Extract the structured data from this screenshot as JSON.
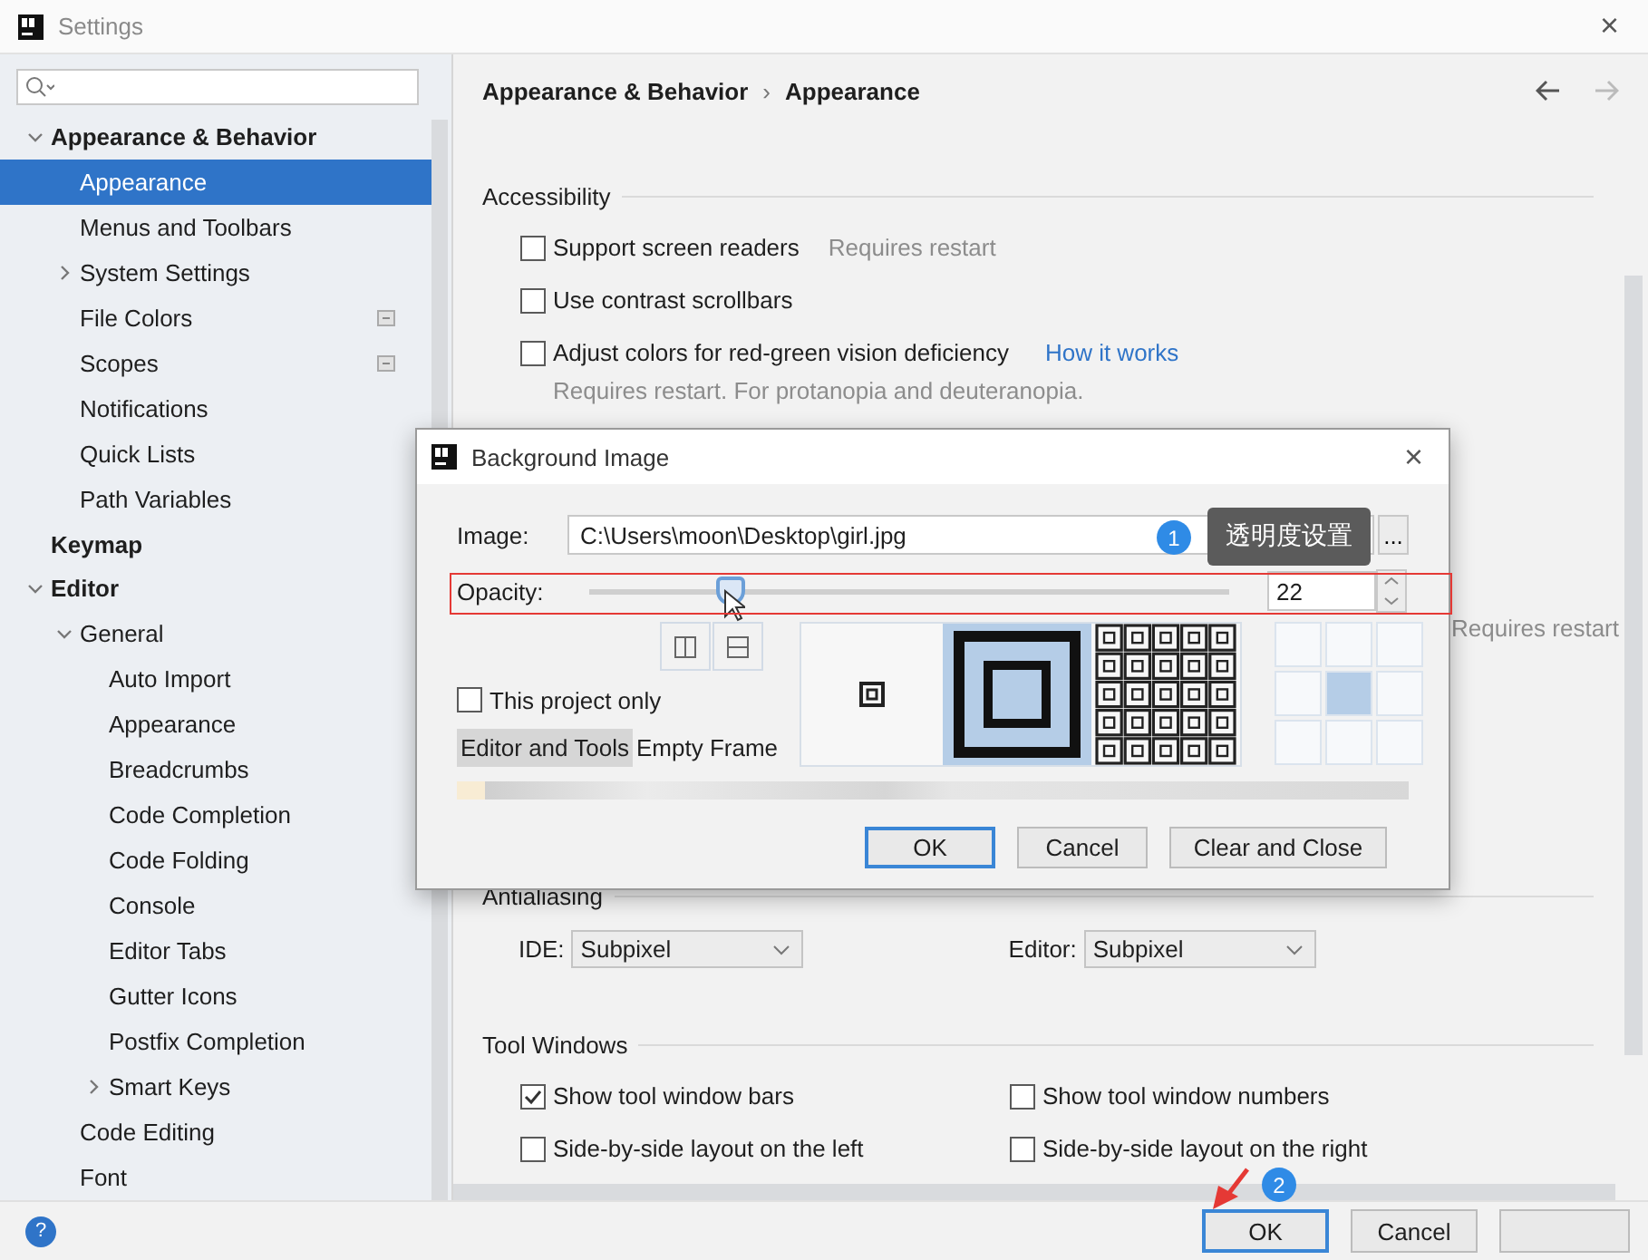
{
  "window": {
    "title": "Settings",
    "close": "×"
  },
  "sidebar": {
    "items": [
      {
        "label": "Appearance & Behavior",
        "bold": true,
        "expanded": true,
        "children": [
          {
            "label": "Appearance",
            "selected": true
          },
          {
            "label": "Menus and Toolbars",
            "selected": false
          },
          {
            "label": "System Settings",
            "selected": false,
            "expanded": false
          },
          {
            "label": "File Colors",
            "selected": false,
            "kind": "project"
          },
          {
            "label": "Scopes",
            "selected": false,
            "kind": "project"
          },
          {
            "label": "Notifications",
            "selected": false
          },
          {
            "label": "Quick Lists",
            "selected": false
          },
          {
            "label": "Path Variables",
            "selected": false
          }
        ]
      },
      {
        "label": "Keymap",
        "bold": true,
        "selected": false
      },
      {
        "label": "Editor",
        "bold": true,
        "expanded": true,
        "selected": false,
        "children": [
          {
            "label": "General",
            "expanded": true,
            "selected": false,
            "children": [
              {
                "label": "Auto Import",
                "selected": false
              },
              {
                "label": "Appearance",
                "selected": false
              },
              {
                "label": "Breadcrumbs",
                "selected": false
              },
              {
                "label": "Code Completion",
                "selected": false
              },
              {
                "label": "Code Folding",
                "selected": false
              },
              {
                "label": "Console",
                "selected": false
              },
              {
                "label": "Editor Tabs",
                "selected": false
              },
              {
                "label": "Gutter Icons",
                "selected": false
              },
              {
                "label": "Postfix Completion",
                "selected": false
              },
              {
                "label": "Smart Keys",
                "selected": false,
                "expanded": false
              }
            ]
          },
          {
            "label": "Code Editing",
            "selected": false
          },
          {
            "label": "Font",
            "selected": false
          }
        ]
      }
    ]
  },
  "breadcrumb": {
    "parts": [
      "Appearance & Behavior",
      "Appearance"
    ],
    "separator": "›"
  },
  "accessibility": {
    "title": "Accessibility",
    "options": [
      {
        "label": "Support screen readers",
        "checked": false,
        "hint": "Requires restart"
      },
      {
        "label": "Use contrast scrollbars",
        "checked": false
      },
      {
        "label": "Adjust colors for red-green vision deficiency",
        "checked": false,
        "link": "How it works",
        "note": "Requires restart. For protanopia and deuteranopia."
      }
    ]
  },
  "partly_covered_hint": "Requires restart",
  "antialiasing": {
    "title": "Antialiasing",
    "combos": [
      {
        "label": "IDE:",
        "value": "Subpixel"
      },
      {
        "label": "Editor:",
        "value": "Subpixel"
      }
    ]
  },
  "tool_windows": {
    "title": "Tool Windows",
    "options": [
      {
        "label": "Show tool window bars",
        "checked": true
      },
      {
        "label": "Show tool window numbers",
        "checked": false
      },
      {
        "label": "Side-by-side layout on the left",
        "checked": false
      },
      {
        "label": "Side-by-side layout on the right",
        "checked": false
      }
    ]
  },
  "footer": {
    "help": "?",
    "buttons": [
      {
        "label": "OK",
        "default": true
      },
      {
        "label": "Cancel",
        "default": false
      }
    ]
  },
  "dialog": {
    "title": "Background Image",
    "close": "×",
    "image": {
      "label": "Image:",
      "value": "C:\\Users\\moon\\Desktop\\girl.jpg",
      "browse": "..."
    },
    "opacity": {
      "label": "Opacity:",
      "level": 0.22,
      "value": "22"
    },
    "this_project_only": {
      "label": "This project only",
      "checked": false
    },
    "targets": [
      {
        "label": "Editor and Tools",
        "selected": true
      },
      {
        "label": "Empty Frame",
        "selected": false
      }
    ],
    "fill_modes": [
      {
        "kind": "centered",
        "selected": false
      },
      {
        "kind": "scaled",
        "selected": true
      },
      {
        "kind": "tiled",
        "selected": false
      }
    ],
    "anchors": [
      {
        "selected": false
      },
      {
        "selected": false
      },
      {
        "selected": false
      },
      {
        "selected": false
      },
      {
        "selected": true
      },
      {
        "selected": false
      },
      {
        "selected": false
      },
      {
        "selected": false
      },
      {
        "selected": false
      }
    ],
    "buttons": [
      {
        "label": "OK",
        "default": true
      },
      {
        "label": "Cancel",
        "default": false
      },
      {
        "label": "Clear and Close",
        "default": false
      }
    ]
  },
  "annotations": [
    {
      "number": "1",
      "text": "透明度设置"
    },
    {
      "number": "2"
    }
  ]
}
